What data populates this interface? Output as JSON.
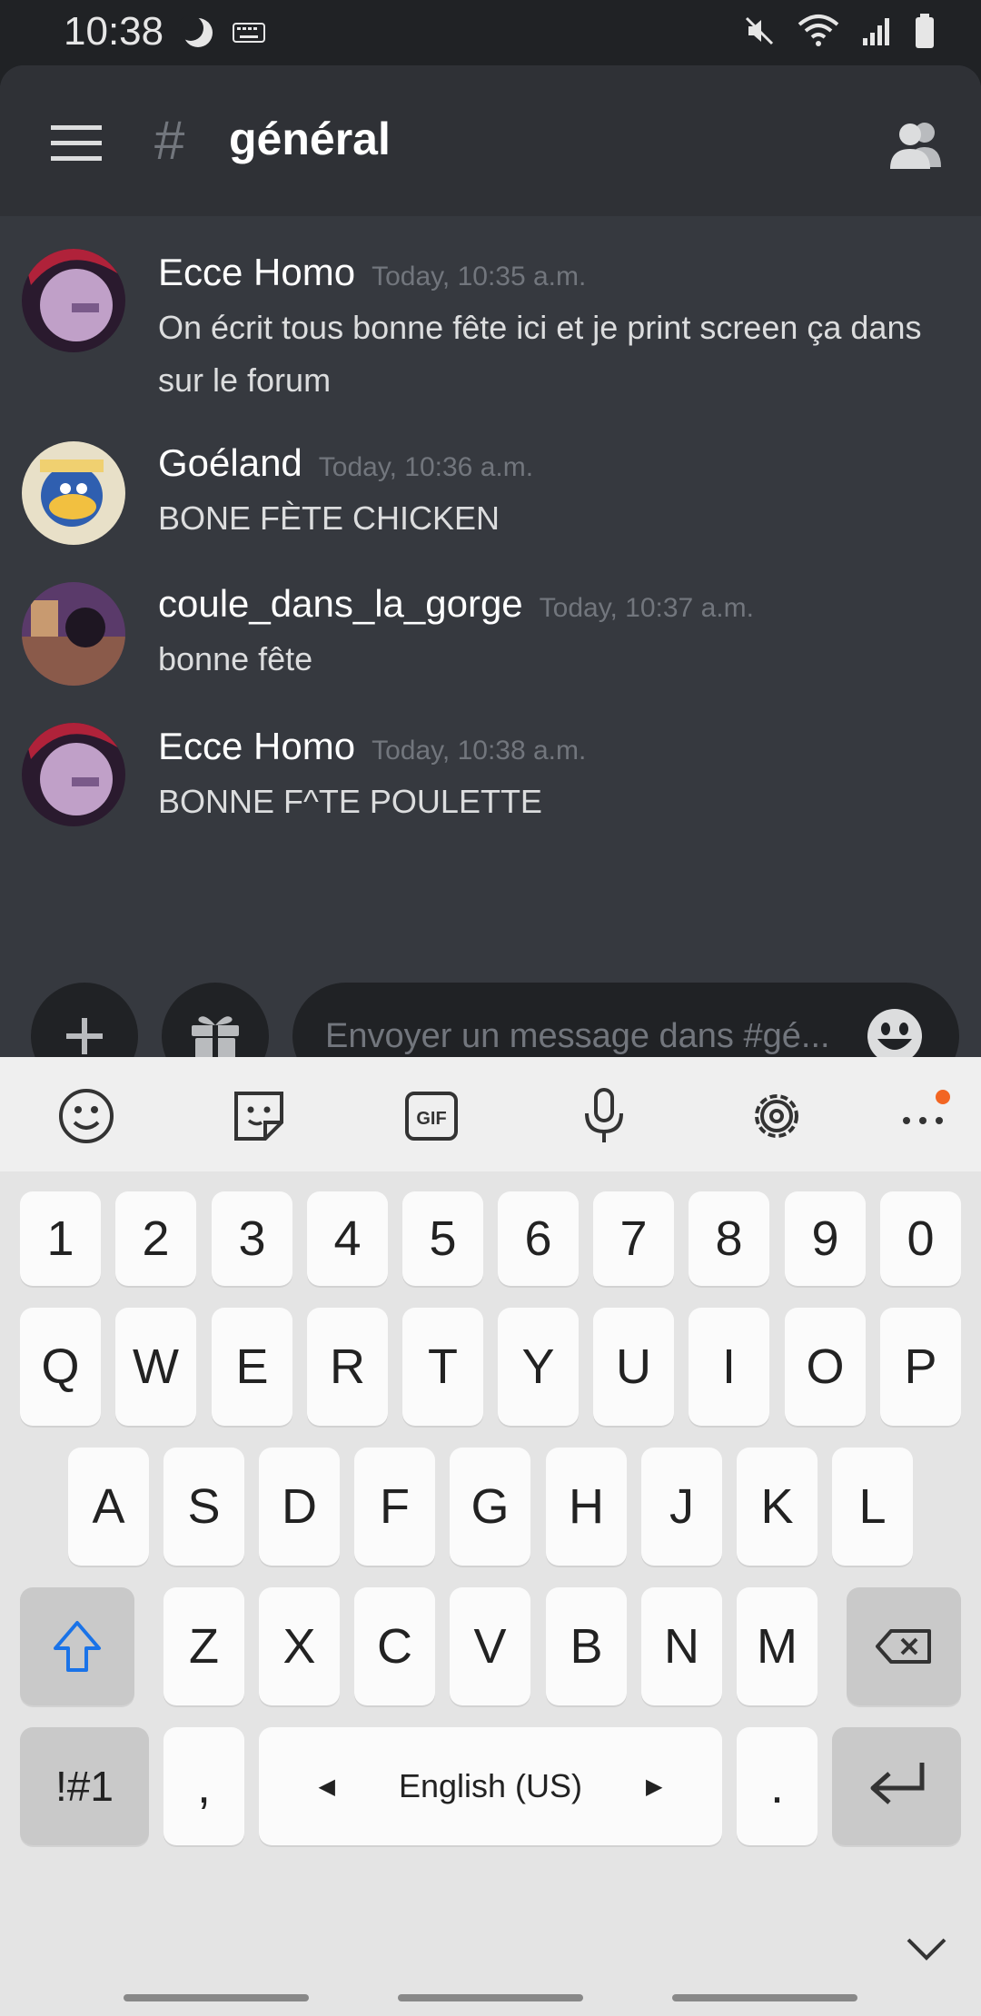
{
  "status": {
    "time": "10:38"
  },
  "channel": {
    "name": "général"
  },
  "messages": [
    {
      "author": "Ecce Homo",
      "timestamp": "Today, 10:35 a.m.",
      "text": "On écrit tous bonne fête ici et je print screen ça dans sur le forum"
    },
    {
      "author": "Goéland",
      "timestamp": "Today, 10:36 a.m.",
      "text": "BONE FÈTE CHICKEN"
    },
    {
      "author": "coule_dans_la_gorge",
      "timestamp": "Today, 10:37 a.m.",
      "text": "bonne fête"
    },
    {
      "author": "Ecce Homo",
      "timestamp": "Today, 10:38 a.m.",
      "text": "BONNE F^TE POULETTE"
    }
  ],
  "composer": {
    "placeholder": "Envoyer un message dans #gé..."
  },
  "keyboard": {
    "toolbar": [
      "emoji-icon",
      "sticker-icon",
      "gif-icon",
      "mic-icon",
      "settings-icon",
      "more-icon"
    ],
    "rows": [
      [
        "1",
        "2",
        "3",
        "4",
        "5",
        "6",
        "7",
        "8",
        "9",
        "0"
      ],
      [
        "Q",
        "W",
        "E",
        "R",
        "T",
        "Y",
        "U",
        "I",
        "O",
        "P"
      ],
      [
        "A",
        "S",
        "D",
        "F",
        "G",
        "H",
        "J",
        "K",
        "L"
      ],
      [
        "Z",
        "X",
        "C",
        "V",
        "B",
        "N",
        "M"
      ]
    ],
    "symbols_label": "!#1",
    "comma": ",",
    "space_label": "English (US)",
    "period": "."
  },
  "colors": {
    "header": "#2f3136",
    "chat_bg": "#36393f",
    "accent_shift": "#1a73e8",
    "notification_dot": "#f26522"
  }
}
